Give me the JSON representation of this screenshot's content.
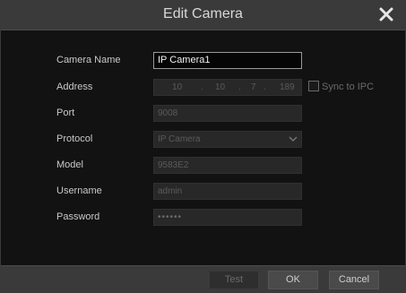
{
  "dialog": {
    "title": "Edit Camera"
  },
  "form": {
    "camera_name": {
      "label": "Camera Name",
      "value": "IP Camera1"
    },
    "address": {
      "label": "Address",
      "octets": [
        "10",
        "10",
        "7",
        "189"
      ],
      "sync_label": "Sync to IPC",
      "sync_checked": false
    },
    "port": {
      "label": "Port",
      "value": "9008"
    },
    "protocol": {
      "label": "Protocol",
      "value": "IP Camera"
    },
    "model": {
      "label": "Model",
      "value": "9583E2"
    },
    "username": {
      "label": "Username",
      "value": "admin"
    },
    "password": {
      "label": "Password",
      "masked": "••••••"
    }
  },
  "buttons": {
    "test": "Test",
    "ok": "OK",
    "cancel": "Cancel"
  },
  "icons": {
    "close": "close-icon",
    "dropdown": "chevron-down-icon"
  }
}
